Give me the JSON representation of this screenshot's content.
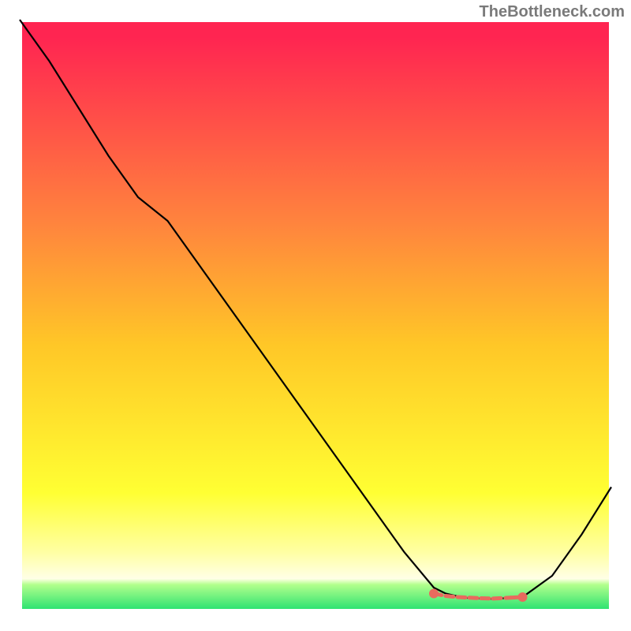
{
  "attribution": "TheBottleneck.com",
  "chart_data": {
    "type": "line",
    "xlim": [
      0,
      100
    ],
    "ylim": [
      0,
      100
    ],
    "xlabel": "",
    "ylabel": "",
    "title": "",
    "grid": false,
    "background_gradient_stops": [
      {
        "offset": 0.03,
        "color": "#ff2551"
      },
      {
        "offset": 0.35,
        "color": "#ff863d"
      },
      {
        "offset": 0.55,
        "color": "#ffc727"
      },
      {
        "offset": 0.8,
        "color": "#ffff33"
      },
      {
        "offset": 0.9,
        "color": "#ffffa3"
      },
      {
        "offset": 0.945,
        "color": "#ffffe6"
      },
      {
        "offset": 0.955,
        "color": "#b2ff8c"
      },
      {
        "offset": 1.0,
        "color": "#22e06f"
      }
    ],
    "series": [
      {
        "name": "bottleneck-curve",
        "type": "line",
        "color": "#000000",
        "x": [
          0,
          5,
          10,
          15,
          20,
          25,
          30,
          35,
          40,
          45,
          50,
          55,
          60,
          65,
          70,
          72,
          75,
          80,
          85,
          90,
          95,
          100
        ],
        "y": [
          100,
          93,
          85,
          77,
          70,
          66,
          59,
          52,
          45,
          38,
          31,
          24,
          17,
          10,
          4,
          3,
          2.3,
          2.1,
          2.4,
          6,
          13,
          21
        ]
      },
      {
        "name": "optimal-range-markers",
        "type": "scatter",
        "color": "#e86a5e",
        "x": [
          70,
          72,
          74,
          76,
          78,
          80,
          83,
          85
        ],
        "y": [
          3.0,
          2.6,
          2.4,
          2.3,
          2.2,
          2.15,
          2.3,
          2.4
        ]
      }
    ]
  }
}
